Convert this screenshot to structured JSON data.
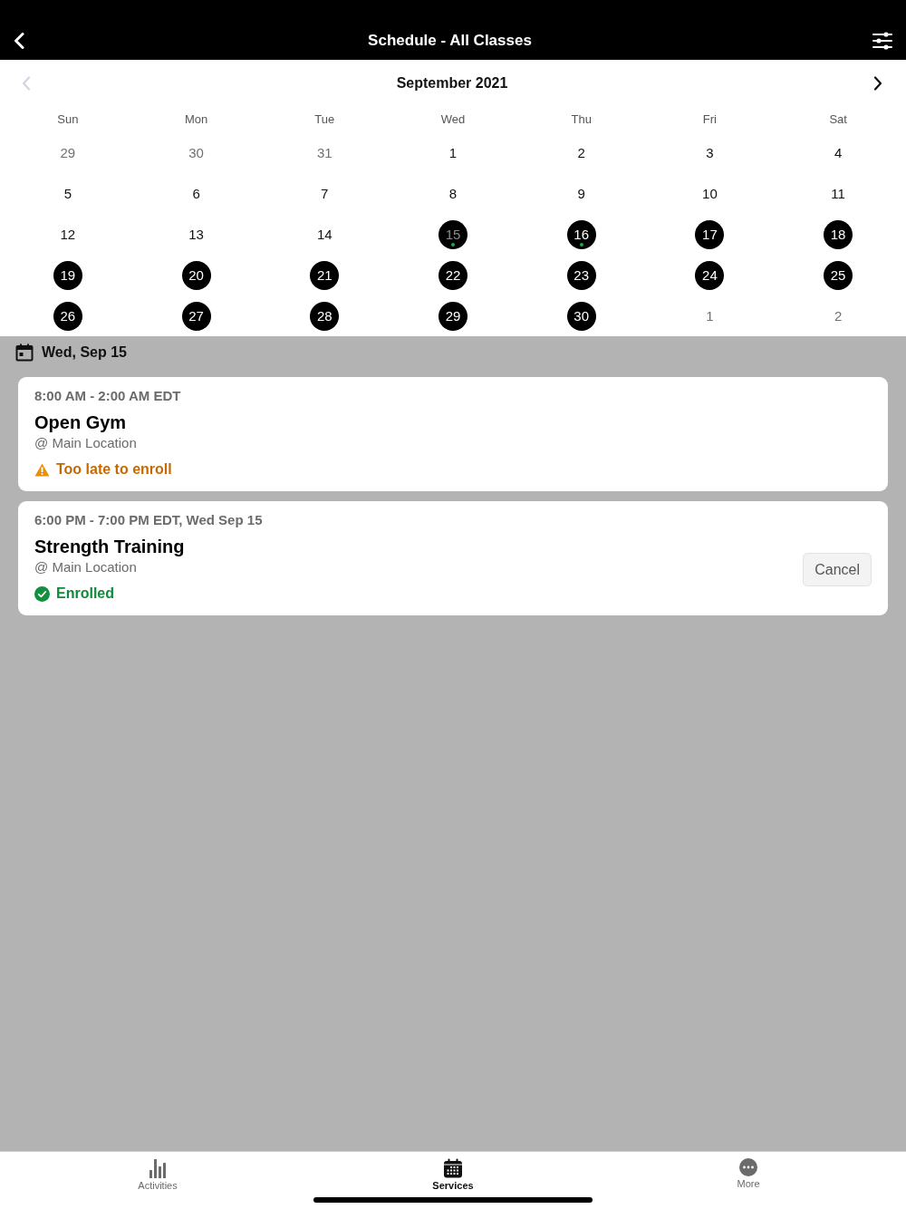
{
  "header": {
    "title": "Schedule - All Classes"
  },
  "calendar": {
    "month": "September 2021",
    "prev": {
      "disabled": true
    },
    "next": {
      "disabled": false
    },
    "weekdays": [
      "Sun",
      "Mon",
      "Tue",
      "Wed",
      "Thu",
      "Fri",
      "Sat"
    ],
    "weeks": [
      {
        "days": [
          {
            "label": "29",
            "outside": true,
            "marked": false,
            "selected": false,
            "dot": false
          },
          {
            "label": "30",
            "outside": true,
            "marked": false,
            "selected": false,
            "dot": false
          },
          {
            "label": "31",
            "outside": true,
            "marked": false,
            "selected": false,
            "dot": false
          },
          {
            "label": "1",
            "outside": false,
            "marked": false,
            "selected": false,
            "dot": false
          },
          {
            "label": "2",
            "outside": false,
            "marked": false,
            "selected": false,
            "dot": false
          },
          {
            "label": "3",
            "outside": false,
            "marked": false,
            "selected": false,
            "dot": false
          },
          {
            "label": "4",
            "outside": false,
            "marked": false,
            "selected": false,
            "dot": false
          }
        ]
      },
      {
        "days": [
          {
            "label": "5",
            "outside": false,
            "marked": false,
            "selected": false,
            "dot": false
          },
          {
            "label": "6",
            "outside": false,
            "marked": false,
            "selected": false,
            "dot": false
          },
          {
            "label": "7",
            "outside": false,
            "marked": false,
            "selected": false,
            "dot": false
          },
          {
            "label": "8",
            "outside": false,
            "marked": false,
            "selected": false,
            "dot": false
          },
          {
            "label": "9",
            "outside": false,
            "marked": false,
            "selected": false,
            "dot": false
          },
          {
            "label": "10",
            "outside": false,
            "marked": false,
            "selected": false,
            "dot": false
          },
          {
            "label": "11",
            "outside": false,
            "marked": false,
            "selected": false,
            "dot": false
          }
        ]
      },
      {
        "days": [
          {
            "label": "12",
            "outside": false,
            "marked": false,
            "selected": false,
            "dot": false
          },
          {
            "label": "13",
            "outside": false,
            "marked": false,
            "selected": false,
            "dot": false
          },
          {
            "label": "14",
            "outside": false,
            "marked": false,
            "selected": false,
            "dot": false
          },
          {
            "label": "15",
            "outside": false,
            "marked": true,
            "selected": true,
            "dot": true
          },
          {
            "label": "16",
            "outside": false,
            "marked": true,
            "selected": false,
            "dot": true
          },
          {
            "label": "17",
            "outside": false,
            "marked": true,
            "selected": false,
            "dot": false
          },
          {
            "label": "18",
            "outside": false,
            "marked": true,
            "selected": false,
            "dot": false
          }
        ]
      },
      {
        "days": [
          {
            "label": "19",
            "outside": false,
            "marked": true,
            "selected": false,
            "dot": false
          },
          {
            "label": "20",
            "outside": false,
            "marked": true,
            "selected": false,
            "dot": false
          },
          {
            "label": "21",
            "outside": false,
            "marked": true,
            "selected": false,
            "dot": false
          },
          {
            "label": "22",
            "outside": false,
            "marked": true,
            "selected": false,
            "dot": false
          },
          {
            "label": "23",
            "outside": false,
            "marked": true,
            "selected": false,
            "dot": false
          },
          {
            "label": "24",
            "outside": false,
            "marked": true,
            "selected": false,
            "dot": false
          },
          {
            "label": "25",
            "outside": false,
            "marked": true,
            "selected": false,
            "dot": false
          }
        ]
      },
      {
        "days": [
          {
            "label": "26",
            "outside": false,
            "marked": true,
            "selected": false,
            "dot": false
          },
          {
            "label": "27",
            "outside": false,
            "marked": true,
            "selected": false,
            "dot": false
          },
          {
            "label": "28",
            "outside": false,
            "marked": true,
            "selected": false,
            "dot": false
          },
          {
            "label": "29",
            "outside": false,
            "marked": true,
            "selected": false,
            "dot": false
          },
          {
            "label": "30",
            "outside": false,
            "marked": true,
            "selected": false,
            "dot": false
          },
          {
            "label": "1",
            "outside": true,
            "marked": false,
            "selected": false,
            "dot": false
          },
          {
            "label": "2",
            "outside": true,
            "marked": false,
            "selected": false,
            "dot": false
          }
        ]
      }
    ]
  },
  "selected_date": {
    "label": "Wed, Sep 15"
  },
  "events": [
    {
      "time": "8:00 AM - 2:00 AM EDT",
      "title": "Open Gym",
      "location": "@ Main Location",
      "status": {
        "kind": "warning",
        "text": "Too late to enroll"
      }
    },
    {
      "time": "6:00 PM - 7:00 PM EDT, Wed Sep 15",
      "title": "Strength Training",
      "location": "@ Main Location",
      "status": {
        "kind": "enrolled",
        "text": "Enrolled"
      },
      "action": "Cancel"
    }
  ],
  "tab_bar": {
    "items": [
      {
        "label": "Activities",
        "kind": "chart",
        "selected": false
      },
      {
        "label": "Services",
        "kind": "calendar",
        "selected": true
      },
      {
        "label": "More",
        "kind": "more",
        "selected": false
      }
    ]
  }
}
